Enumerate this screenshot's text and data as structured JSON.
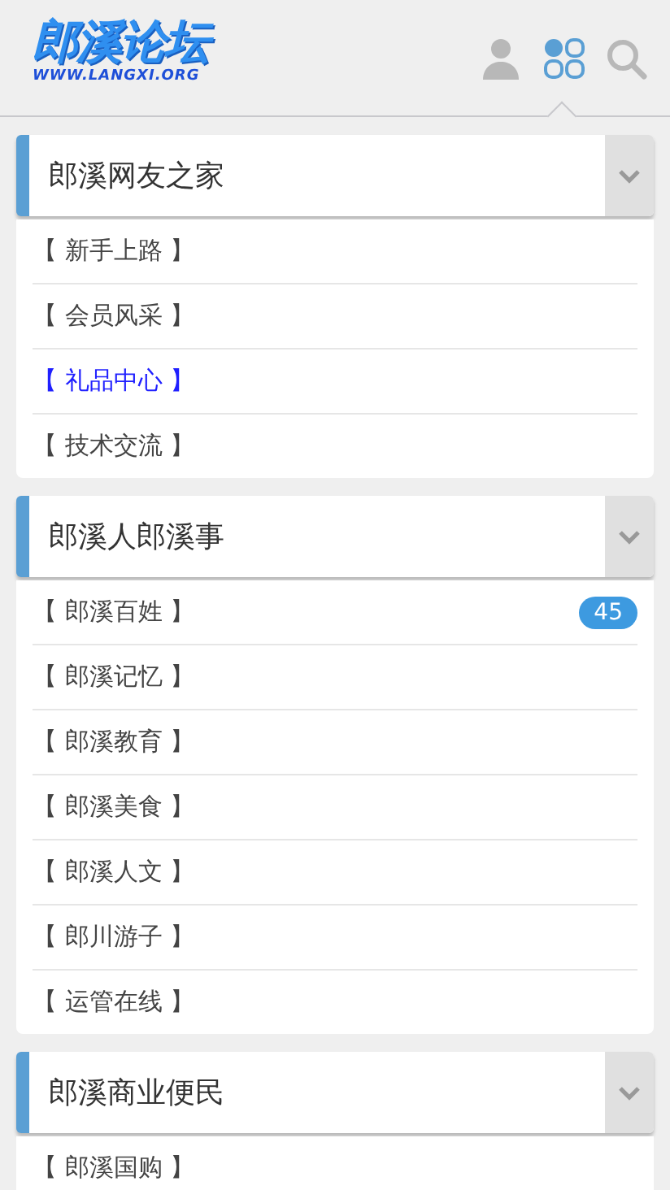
{
  "logo": {
    "title": "郎溪论坛",
    "url": "WWW.LANGXI.ORG"
  },
  "header_icons": [
    {
      "kind": "user",
      "selected": false
    },
    {
      "kind": "grid",
      "selected": true
    },
    {
      "kind": "search",
      "selected": false
    }
  ],
  "sections": [
    {
      "title": "郎溪网友之家",
      "expanded": true,
      "items": [
        {
          "label": "【 新手上路 】",
          "highlighted": false
        },
        {
          "label": "【 会员风采 】",
          "highlighted": false
        },
        {
          "label": "【 礼品中心 】",
          "highlighted": true
        },
        {
          "label": "【 技术交流 】",
          "highlighted": false
        }
      ]
    },
    {
      "title": "郎溪人郎溪事",
      "expanded": true,
      "items": [
        {
          "label": "【 郎溪百姓 】",
          "highlighted": false,
          "badge": "45"
        },
        {
          "label": "【 郎溪记忆 】",
          "highlighted": false
        },
        {
          "label": "【 郎溪教育 】",
          "highlighted": false
        },
        {
          "label": "【 郎溪美食 】",
          "highlighted": false
        },
        {
          "label": "【 郎溪人文 】",
          "highlighted": false
        },
        {
          "label": "【 郎川游子 】",
          "highlighted": false
        },
        {
          "label": "【 运管在线 】",
          "highlighted": false
        }
      ]
    },
    {
      "title": "郎溪商业便民",
      "expanded": true,
      "items": [
        {
          "label": "【 郎溪国购 】",
          "highlighted": false
        }
      ]
    }
  ]
}
